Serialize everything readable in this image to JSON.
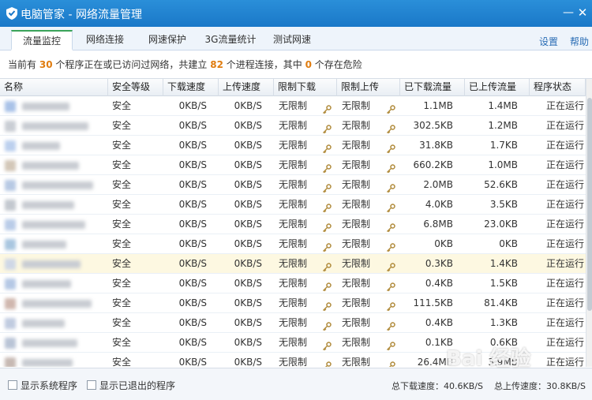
{
  "window": {
    "title": "电脑管家 - 网络流量管理",
    "colors": {
      "titlebar": "#1a78c8",
      "accent_number": "#e07d10",
      "active_tab": "#3aa35a"
    }
  },
  "tabs": [
    {
      "label": "流量监控",
      "active": true
    },
    {
      "label": "网络连接",
      "active": false
    },
    {
      "label": "网速保护",
      "active": false
    },
    {
      "label": "3G流量统计",
      "active": false
    },
    {
      "label": "测试网速",
      "active": false
    }
  ],
  "top_links": {
    "settings": "设置",
    "help": "帮助"
  },
  "summary": {
    "prefix": "当前有",
    "program_count": "30",
    "mid1": "个程序正在或已访问过网络，共建立",
    "connection_count": "82",
    "mid2": "个进程连接，其中",
    "danger_count": "0",
    "suffix": "个存在危险"
  },
  "table": {
    "columns": [
      "名称",
      "安全等级",
      "下载速度",
      "上传速度",
      "限制下载",
      "限制上传",
      "已下载流量",
      "已上传流量",
      "程序状态"
    ],
    "rows": [
      {
        "security": "安全",
        "down": "0KB/S",
        "up": "0KB/S",
        "limit_down": "无限制",
        "limit_up": "无限制",
        "downloaded": "1.1MB",
        "uploaded": "1.4MB",
        "status": "正在运行"
      },
      {
        "security": "安全",
        "down": "0KB/S",
        "up": "0KB/S",
        "limit_down": "无限制",
        "limit_up": "无限制",
        "downloaded": "302.5KB",
        "uploaded": "1.2MB",
        "status": "正在运行"
      },
      {
        "security": "安全",
        "down": "0KB/S",
        "up": "0KB/S",
        "limit_down": "无限制",
        "limit_up": "无限制",
        "downloaded": "31.8KB",
        "uploaded": "1.7KB",
        "status": "正在运行"
      },
      {
        "security": "安全",
        "down": "0KB/S",
        "up": "0KB/S",
        "limit_down": "无限制",
        "limit_up": "无限制",
        "downloaded": "660.2KB",
        "uploaded": "1.0MB",
        "status": "正在运行"
      },
      {
        "security": "安全",
        "down": "0KB/S",
        "up": "0KB/S",
        "limit_down": "无限制",
        "limit_up": "无限制",
        "downloaded": "2.0MB",
        "uploaded": "52.6KB",
        "status": "正在运行"
      },
      {
        "security": "安全",
        "down": "0KB/S",
        "up": "0KB/S",
        "limit_down": "无限制",
        "limit_up": "无限制",
        "downloaded": "4.0KB",
        "uploaded": "3.5KB",
        "status": "正在运行"
      },
      {
        "security": "安全",
        "down": "0KB/S",
        "up": "0KB/S",
        "limit_down": "无限制",
        "limit_up": "无限制",
        "downloaded": "6.8MB",
        "uploaded": "23.0KB",
        "status": "正在运行"
      },
      {
        "security": "安全",
        "down": "0KB/S",
        "up": "0KB/S",
        "limit_down": "无限制",
        "limit_up": "无限制",
        "downloaded": "0KB",
        "uploaded": "0KB",
        "status": "正在运行"
      },
      {
        "security": "安全",
        "down": "0KB/S",
        "up": "0KB/S",
        "limit_down": "无限制",
        "limit_up": "无限制",
        "downloaded": "0.3KB",
        "uploaded": "1.4KB",
        "status": "正在运行",
        "highlighted": true
      },
      {
        "security": "安全",
        "down": "0KB/S",
        "up": "0KB/S",
        "limit_down": "无限制",
        "limit_up": "无限制",
        "downloaded": "0.4KB",
        "uploaded": "1.5KB",
        "status": "正在运行"
      },
      {
        "security": "安全",
        "down": "0KB/S",
        "up": "0KB/S",
        "limit_down": "无限制",
        "limit_up": "无限制",
        "downloaded": "111.5KB",
        "uploaded": "81.4KB",
        "status": "正在运行"
      },
      {
        "security": "安全",
        "down": "0KB/S",
        "up": "0KB/S",
        "limit_down": "无限制",
        "limit_up": "无限制",
        "downloaded": "0.4KB",
        "uploaded": "1.3KB",
        "status": "正在运行"
      },
      {
        "security": "安全",
        "down": "0KB/S",
        "up": "0KB/S",
        "limit_down": "无限制",
        "limit_up": "无限制",
        "downloaded": "0.1KB",
        "uploaded": "0.6KB",
        "status": "正在运行"
      },
      {
        "security": "安全",
        "down": "0KB/S",
        "up": "0KB/S",
        "limit_down": "无限制",
        "limit_up": "无限制",
        "downloaded": "26.4MB",
        "uploaded": "3.9MB",
        "status": "正在运行"
      }
    ]
  },
  "footer": {
    "show_system_label": "显示系统程序",
    "show_exited_label": "显示已退出的程序",
    "total_down": "总下载速度：40.6KB/S",
    "total_up": "总上传速度：30.8KB/S"
  },
  "watermark": "Bai 经验"
}
